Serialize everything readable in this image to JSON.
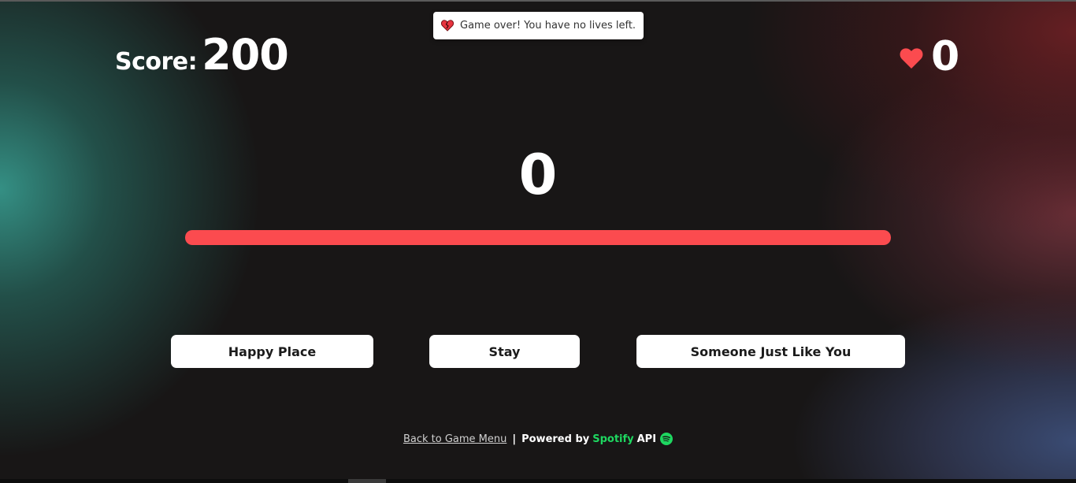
{
  "toast": {
    "message": "Game over! You have no lives left.",
    "icon": "broken-heart-icon"
  },
  "score": {
    "label": "Score:",
    "value": "200"
  },
  "lives": {
    "icon": "heart-icon",
    "value": "0"
  },
  "timer": {
    "value": "0"
  },
  "progress": {
    "fraction": 1.0,
    "color": "#fb4b4f"
  },
  "choices": [
    {
      "label": "Happy Place"
    },
    {
      "label": "Stay"
    },
    {
      "label": "Someone Just Like You"
    }
  ],
  "footer": {
    "back_link": "Back to Game Menu",
    "separator": "|",
    "powered_by": "Powered by",
    "spotify": "Spotify",
    "api": "API",
    "spotify_icon": "spotify-logo-icon"
  },
  "colors": {
    "accent_red": "#fb4b4f",
    "spotify_green": "#1ed760"
  }
}
